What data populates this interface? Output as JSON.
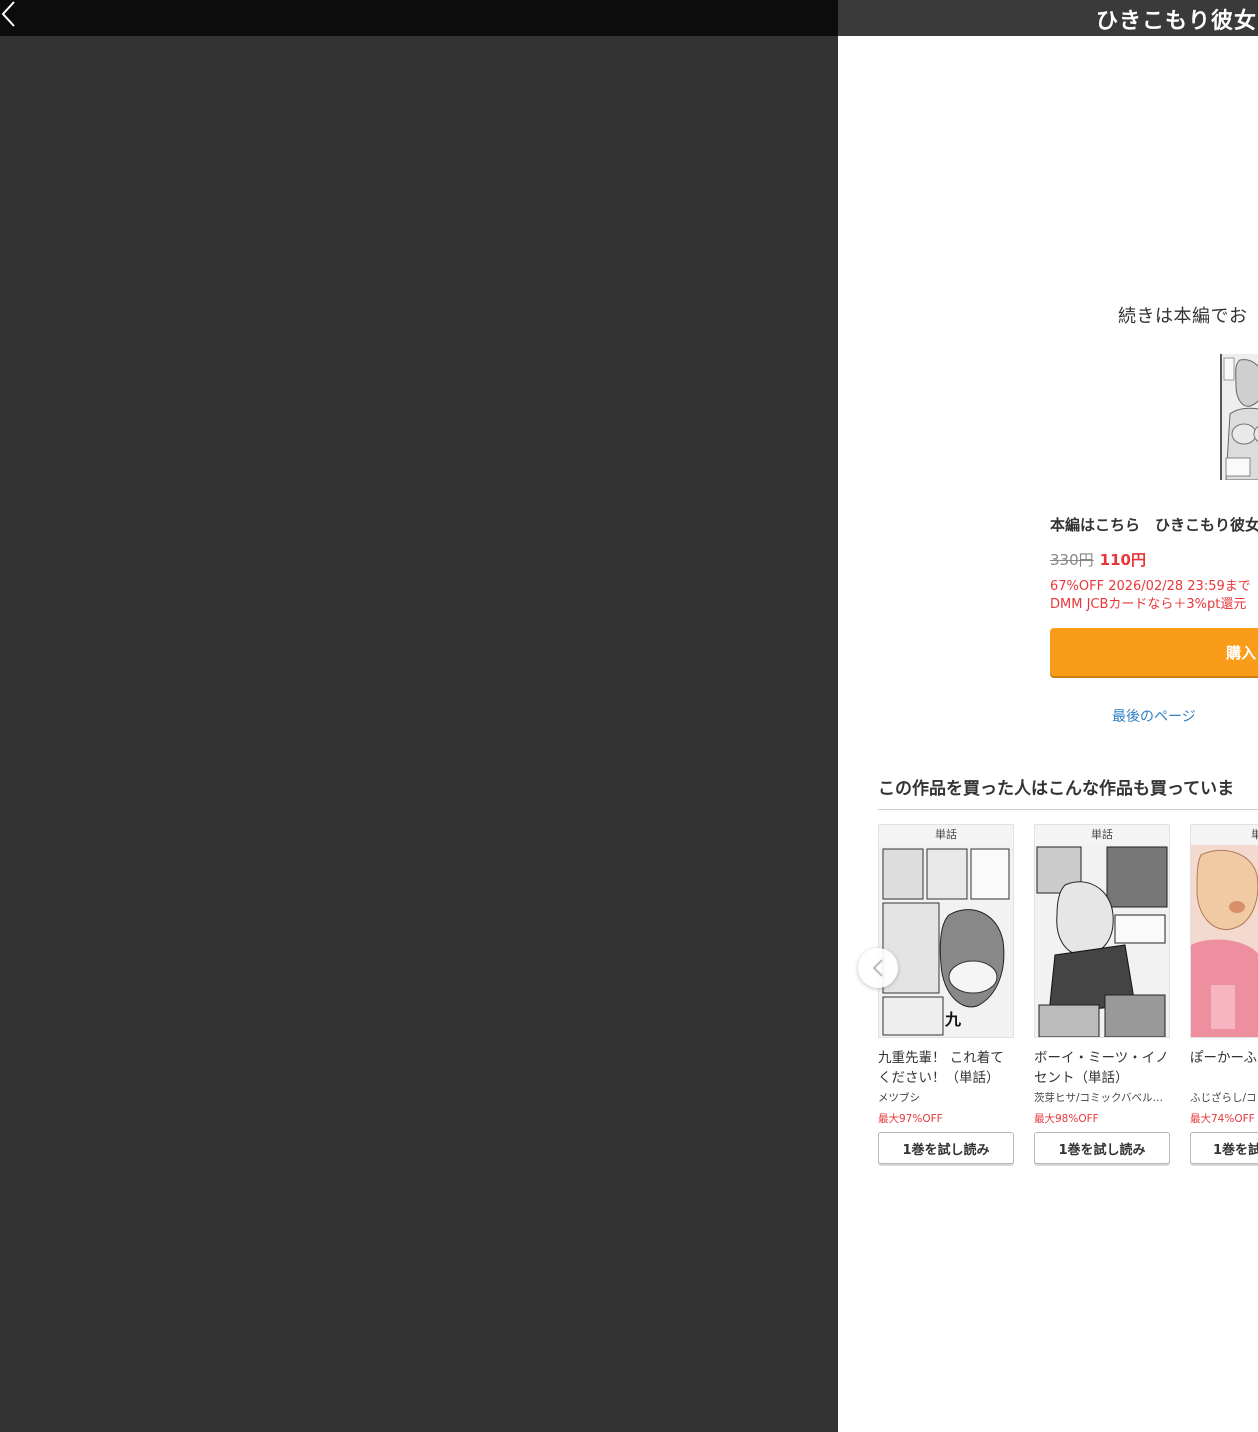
{
  "header": {
    "back_icon": "chevron-left-icon",
    "title": "ひきこもり彼女"
  },
  "end_panel": {
    "continue_text": "続きは本編でお",
    "main_link": "本編はこちら　ひきこもり彼女",
    "price_old": "330円",
    "price_new": "110円",
    "sale_line1": "67%OFF 2026/02/28 23:59まで",
    "sale_line2": "DMM JCBカードなら＋3%pt還元",
    "buy_label": "購入",
    "last_page_label": "最後のページ"
  },
  "recommendations": {
    "heading": "この作品を買った人はこんな作品も買っていま",
    "prev_icon": "chevron-left-icon",
    "items": [
      {
        "badge": "単話",
        "title": "九重先輩！ これ着てください！（単話）",
        "author": "メツブシ",
        "discount": "最大97%OFF",
        "button": "1巻を試し読み"
      },
      {
        "badge": "単話",
        "title": "ボーイ・ミーツ・イノセント（単話）",
        "author": "茨芽ヒサ/コミックバベル…",
        "discount": "最大98%OFF",
        "button": "1巻を試し読み"
      },
      {
        "badge": "単",
        "title": "ぽーかーふ（単話）",
        "author": "ふじざらし/コ",
        "discount": "最大74%OFF",
        "button": "1巻を試"
      }
    ]
  },
  "colors": {
    "viewer_bg": "#333333",
    "accent_orange": "#f99c1a",
    "sale_red": "#e8373a",
    "link_blue": "#2f80c4"
  }
}
